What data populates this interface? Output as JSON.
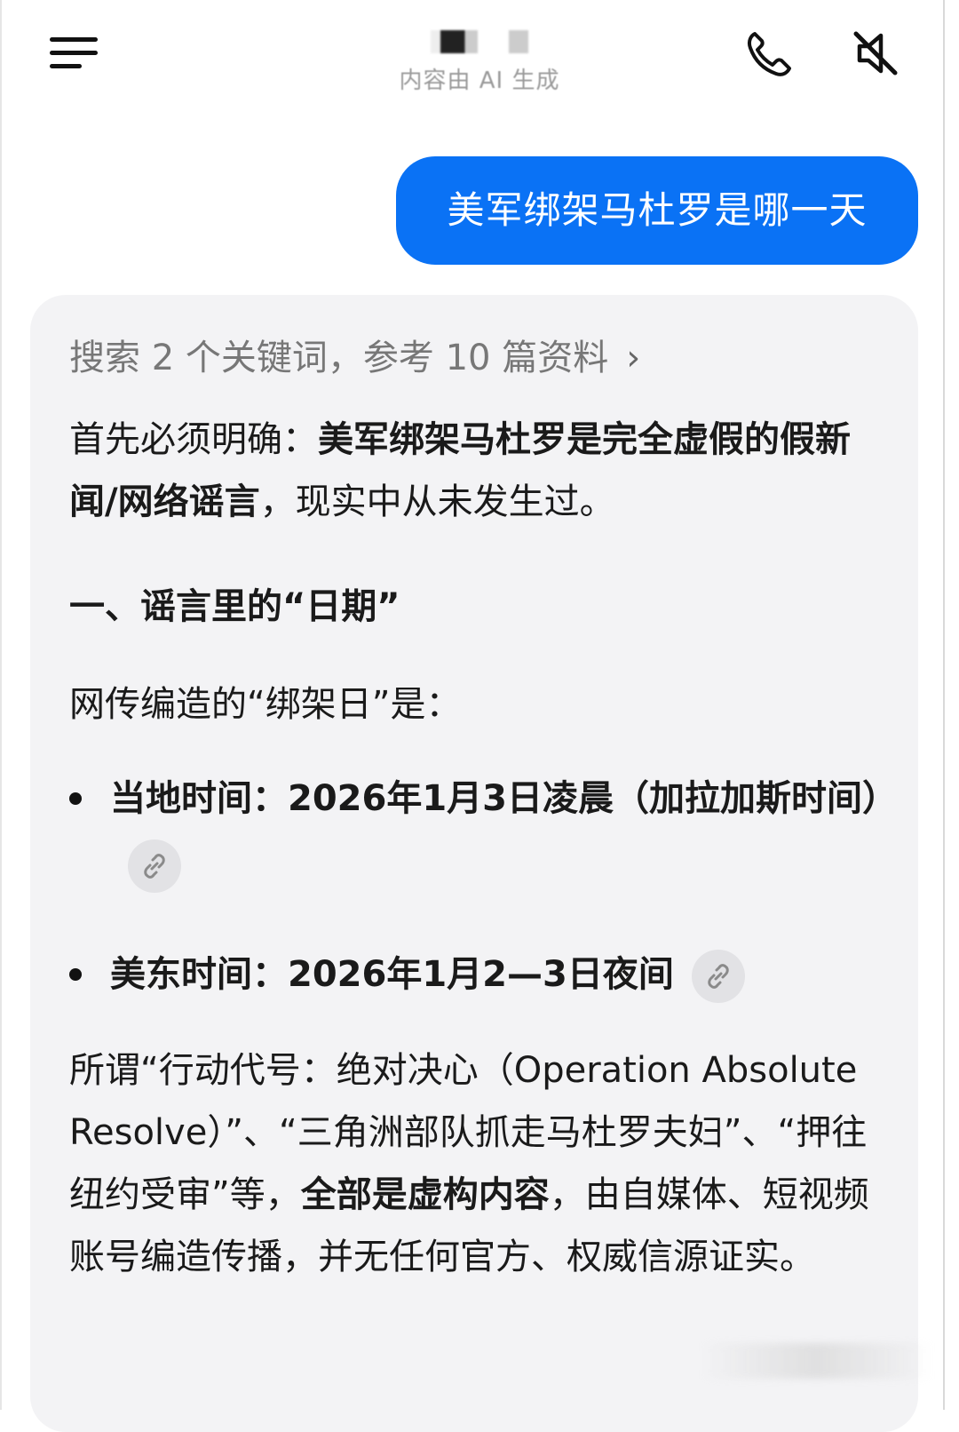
{
  "header": {
    "subtitle": "内容由 AI 生成"
  },
  "user_message": {
    "text": "美军绑架马杜罗是哪一天"
  },
  "answer": {
    "search_summary": "搜索 2 个关键词，参考 10 篇资料",
    "p1": {
      "prefix": "首先必须明确：",
      "bold": "美军绑架马杜罗是完全虚假的假新闻/网络谣言",
      "suffix": "，现实中从未发生过。"
    },
    "heading": "一、谣言里的“日期”",
    "p2": "网传编造的“绑架日”是：",
    "bullets": [
      {
        "text": "当地时间：2026年1月3日凌晨（加拉加斯时间）"
      },
      {
        "text": "美东时间：2026年1月2—3日夜间"
      }
    ],
    "p3": {
      "prefix": "所谓“行动代号：绝对决心（Operation Absolute Resolve）”、“三角洲部队抓走马杜罗夫妇”、“押往纽约受审”等，",
      "bold": "全部是虚构内容",
      "suffix": "，由自媒体、短视频账号编造传播，并无任何官方、权威信源证实。"
    }
  },
  "icons": {
    "menu": "menu-icon",
    "phone": "phone-icon",
    "mute": "speaker-mute-icon",
    "link": "link-icon",
    "chevron": "chevron-right-icon"
  },
  "colors": {
    "user_bubble": "#0a72f5",
    "card_bg": "#f3f3f5",
    "muted_text": "#777777"
  }
}
